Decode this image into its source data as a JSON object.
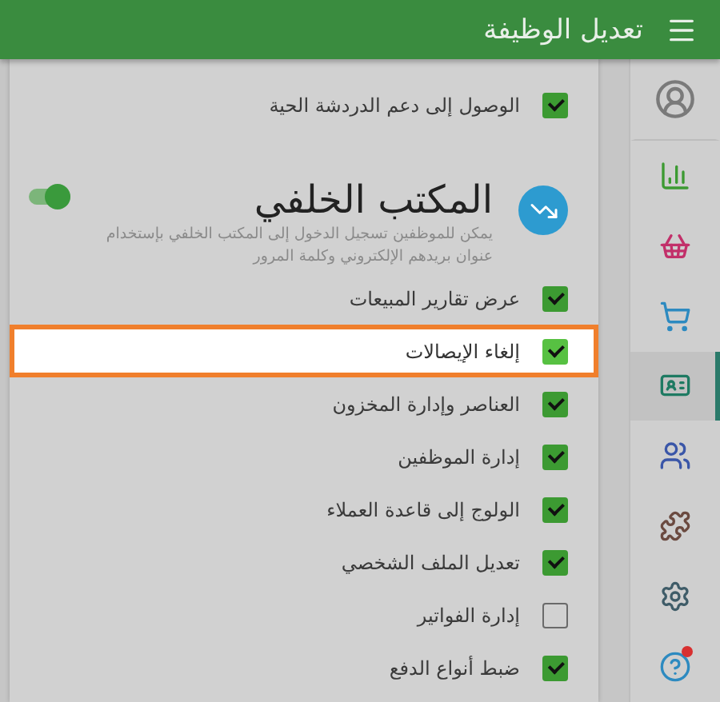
{
  "header": {
    "title": "تعديل الوظيفة"
  },
  "permissions": [
    {
      "label": "الوصول إلى دعم الدردشة الحية",
      "checked": true,
      "highlighted": false
    }
  ],
  "section": {
    "title": "المكتب الخلفي",
    "description": "يمكن للموظفين تسجيل الدخول إلى المكتب الخلفي بإستخدام عنوان بريدهم الإلكتروني وكلمة المرور",
    "on": true,
    "items": [
      {
        "label": "عرض تقارير المبيعات",
        "checked": true,
        "highlighted": false
      },
      {
        "label": "إلغاء الإيصالات",
        "checked": true,
        "highlighted": true
      },
      {
        "label": "العناصر وإدارة المخزون",
        "checked": true,
        "highlighted": false
      },
      {
        "label": "إدارة الموظفين",
        "checked": true,
        "highlighted": false
      },
      {
        "label": "الولوج إلى قاعدة العملاء",
        "checked": true,
        "highlighted": false
      },
      {
        "label": "تعديل الملف الشخصي",
        "checked": true,
        "highlighted": false
      },
      {
        "label": "إدارة الفواتير",
        "checked": false,
        "highlighted": false
      },
      {
        "label": "ضبط أنواع الدفع",
        "checked": true,
        "highlighted": false
      }
    ]
  },
  "sidebar": [
    {
      "kind": "user",
      "selected": false
    },
    {
      "kind": "chart",
      "selected": false
    },
    {
      "kind": "basket",
      "selected": false
    },
    {
      "kind": "cart",
      "selected": false
    },
    {
      "kind": "card",
      "selected": true
    },
    {
      "kind": "people",
      "selected": false
    },
    {
      "kind": "puzzle",
      "selected": false
    },
    {
      "kind": "gear",
      "selected": false
    },
    {
      "kind": "help",
      "selected": false
    }
  ]
}
